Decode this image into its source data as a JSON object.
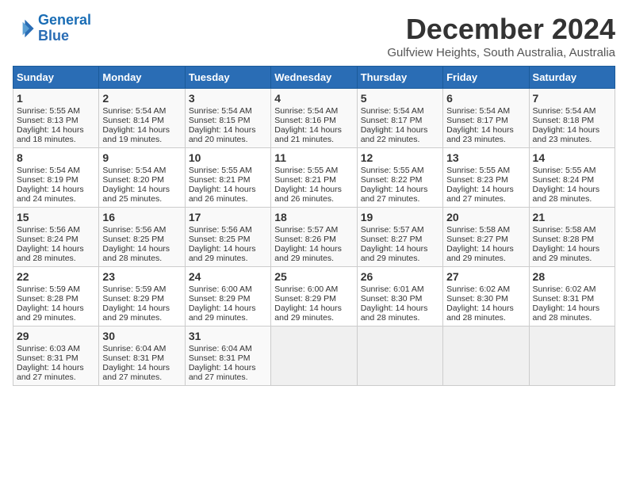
{
  "logo": {
    "line1": "General",
    "line2": "Blue"
  },
  "title": "December 2024",
  "subtitle": "Gulfview Heights, South Australia, Australia",
  "days_of_week": [
    "Sunday",
    "Monday",
    "Tuesday",
    "Wednesday",
    "Thursday",
    "Friday",
    "Saturday"
  ],
  "weeks": [
    [
      {
        "day": "1",
        "lines": [
          "Sunrise: 5:55 AM",
          "Sunset: 8:13 PM",
          "Daylight: 14 hours",
          "and 18 minutes."
        ]
      },
      {
        "day": "2",
        "lines": [
          "Sunrise: 5:54 AM",
          "Sunset: 8:14 PM",
          "Daylight: 14 hours",
          "and 19 minutes."
        ]
      },
      {
        "day": "3",
        "lines": [
          "Sunrise: 5:54 AM",
          "Sunset: 8:15 PM",
          "Daylight: 14 hours",
          "and 20 minutes."
        ]
      },
      {
        "day": "4",
        "lines": [
          "Sunrise: 5:54 AM",
          "Sunset: 8:16 PM",
          "Daylight: 14 hours",
          "and 21 minutes."
        ]
      },
      {
        "day": "5",
        "lines": [
          "Sunrise: 5:54 AM",
          "Sunset: 8:17 PM",
          "Daylight: 14 hours",
          "and 22 minutes."
        ]
      },
      {
        "day": "6",
        "lines": [
          "Sunrise: 5:54 AM",
          "Sunset: 8:17 PM",
          "Daylight: 14 hours",
          "and 23 minutes."
        ]
      },
      {
        "day": "7",
        "lines": [
          "Sunrise: 5:54 AM",
          "Sunset: 8:18 PM",
          "Daylight: 14 hours",
          "and 23 minutes."
        ]
      }
    ],
    [
      {
        "day": "8",
        "lines": [
          "Sunrise: 5:54 AM",
          "Sunset: 8:19 PM",
          "Daylight: 14 hours",
          "and 24 minutes."
        ]
      },
      {
        "day": "9",
        "lines": [
          "Sunrise: 5:54 AM",
          "Sunset: 8:20 PM",
          "Daylight: 14 hours",
          "and 25 minutes."
        ]
      },
      {
        "day": "10",
        "lines": [
          "Sunrise: 5:55 AM",
          "Sunset: 8:21 PM",
          "Daylight: 14 hours",
          "and 26 minutes."
        ]
      },
      {
        "day": "11",
        "lines": [
          "Sunrise: 5:55 AM",
          "Sunset: 8:21 PM",
          "Daylight: 14 hours",
          "and 26 minutes."
        ]
      },
      {
        "day": "12",
        "lines": [
          "Sunrise: 5:55 AM",
          "Sunset: 8:22 PM",
          "Daylight: 14 hours",
          "and 27 minutes."
        ]
      },
      {
        "day": "13",
        "lines": [
          "Sunrise: 5:55 AM",
          "Sunset: 8:23 PM",
          "Daylight: 14 hours",
          "and 27 minutes."
        ]
      },
      {
        "day": "14",
        "lines": [
          "Sunrise: 5:55 AM",
          "Sunset: 8:24 PM",
          "Daylight: 14 hours",
          "and 28 minutes."
        ]
      }
    ],
    [
      {
        "day": "15",
        "lines": [
          "Sunrise: 5:56 AM",
          "Sunset: 8:24 PM",
          "Daylight: 14 hours",
          "and 28 minutes."
        ]
      },
      {
        "day": "16",
        "lines": [
          "Sunrise: 5:56 AM",
          "Sunset: 8:25 PM",
          "Daylight: 14 hours",
          "and 28 minutes."
        ]
      },
      {
        "day": "17",
        "lines": [
          "Sunrise: 5:56 AM",
          "Sunset: 8:25 PM",
          "Daylight: 14 hours",
          "and 29 minutes."
        ]
      },
      {
        "day": "18",
        "lines": [
          "Sunrise: 5:57 AM",
          "Sunset: 8:26 PM",
          "Daylight: 14 hours",
          "and 29 minutes."
        ]
      },
      {
        "day": "19",
        "lines": [
          "Sunrise: 5:57 AM",
          "Sunset: 8:27 PM",
          "Daylight: 14 hours",
          "and 29 minutes."
        ]
      },
      {
        "day": "20",
        "lines": [
          "Sunrise: 5:58 AM",
          "Sunset: 8:27 PM",
          "Daylight: 14 hours",
          "and 29 minutes."
        ]
      },
      {
        "day": "21",
        "lines": [
          "Sunrise: 5:58 AM",
          "Sunset: 8:28 PM",
          "Daylight: 14 hours",
          "and 29 minutes."
        ]
      }
    ],
    [
      {
        "day": "22",
        "lines": [
          "Sunrise: 5:59 AM",
          "Sunset: 8:28 PM",
          "Daylight: 14 hours",
          "and 29 minutes."
        ]
      },
      {
        "day": "23",
        "lines": [
          "Sunrise: 5:59 AM",
          "Sunset: 8:29 PM",
          "Daylight: 14 hours",
          "and 29 minutes."
        ]
      },
      {
        "day": "24",
        "lines": [
          "Sunrise: 6:00 AM",
          "Sunset: 8:29 PM",
          "Daylight: 14 hours",
          "and 29 minutes."
        ]
      },
      {
        "day": "25",
        "lines": [
          "Sunrise: 6:00 AM",
          "Sunset: 8:29 PM",
          "Daylight: 14 hours",
          "and 29 minutes."
        ]
      },
      {
        "day": "26",
        "lines": [
          "Sunrise: 6:01 AM",
          "Sunset: 8:30 PM",
          "Daylight: 14 hours",
          "and 28 minutes."
        ]
      },
      {
        "day": "27",
        "lines": [
          "Sunrise: 6:02 AM",
          "Sunset: 8:30 PM",
          "Daylight: 14 hours",
          "and 28 minutes."
        ]
      },
      {
        "day": "28",
        "lines": [
          "Sunrise: 6:02 AM",
          "Sunset: 8:31 PM",
          "Daylight: 14 hours",
          "and 28 minutes."
        ]
      }
    ],
    [
      {
        "day": "29",
        "lines": [
          "Sunrise: 6:03 AM",
          "Sunset: 8:31 PM",
          "Daylight: 14 hours",
          "and 27 minutes."
        ]
      },
      {
        "day": "30",
        "lines": [
          "Sunrise: 6:04 AM",
          "Sunset: 8:31 PM",
          "Daylight: 14 hours",
          "and 27 minutes."
        ]
      },
      {
        "day": "31",
        "lines": [
          "Sunrise: 6:04 AM",
          "Sunset: 8:31 PM",
          "Daylight: 14 hours",
          "and 27 minutes."
        ]
      },
      null,
      null,
      null,
      null
    ]
  ]
}
